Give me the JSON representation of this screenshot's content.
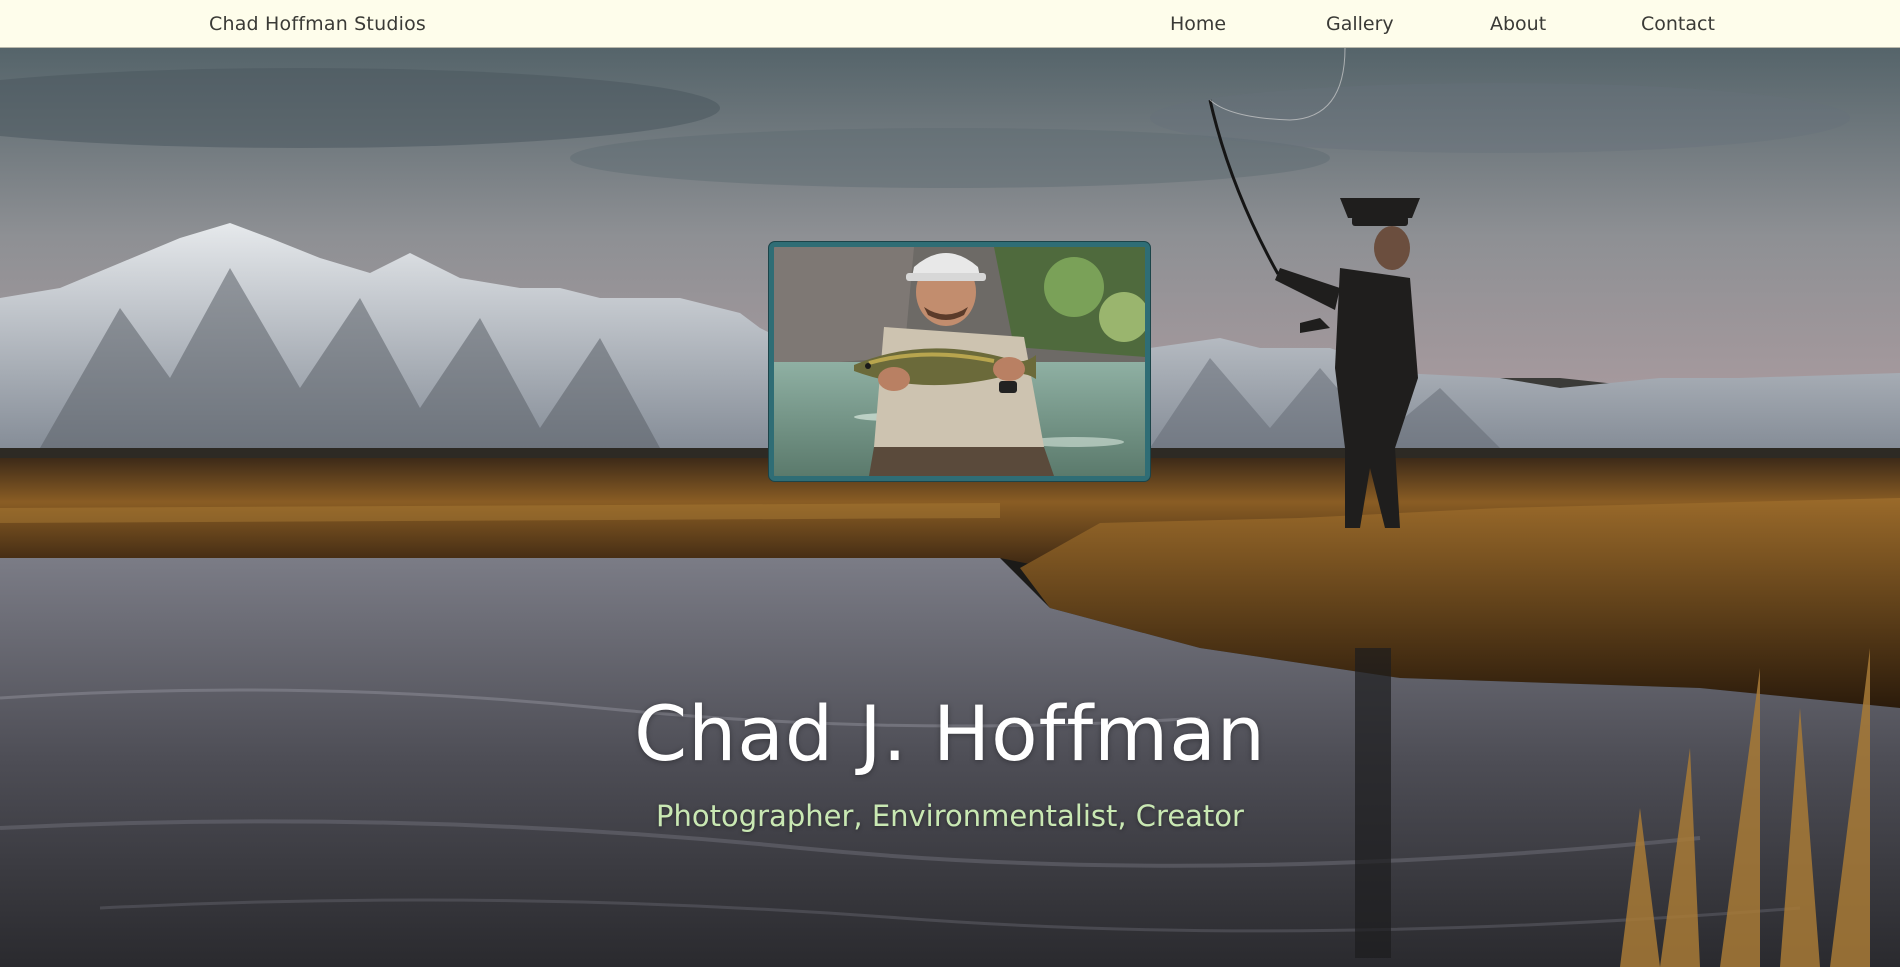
{
  "nav": {
    "brand": "Chad Hoffman Studios",
    "links": [
      "Home",
      "Gallery",
      "About",
      "Contact"
    ]
  },
  "hero": {
    "title": "Chad J. Hoffman",
    "subtitle": "Photographer, Environmentalist, Creator",
    "background": "mountain-river-fly-fisherman-photo",
    "portrait": "man-holding-trout-photo"
  },
  "colors": {
    "nav_background": "#fefdeb",
    "nav_text": "#3a3a36",
    "portrait_border": "#2f6d75",
    "title": "#ffffff",
    "subtitle": "#c9e8b3"
  }
}
